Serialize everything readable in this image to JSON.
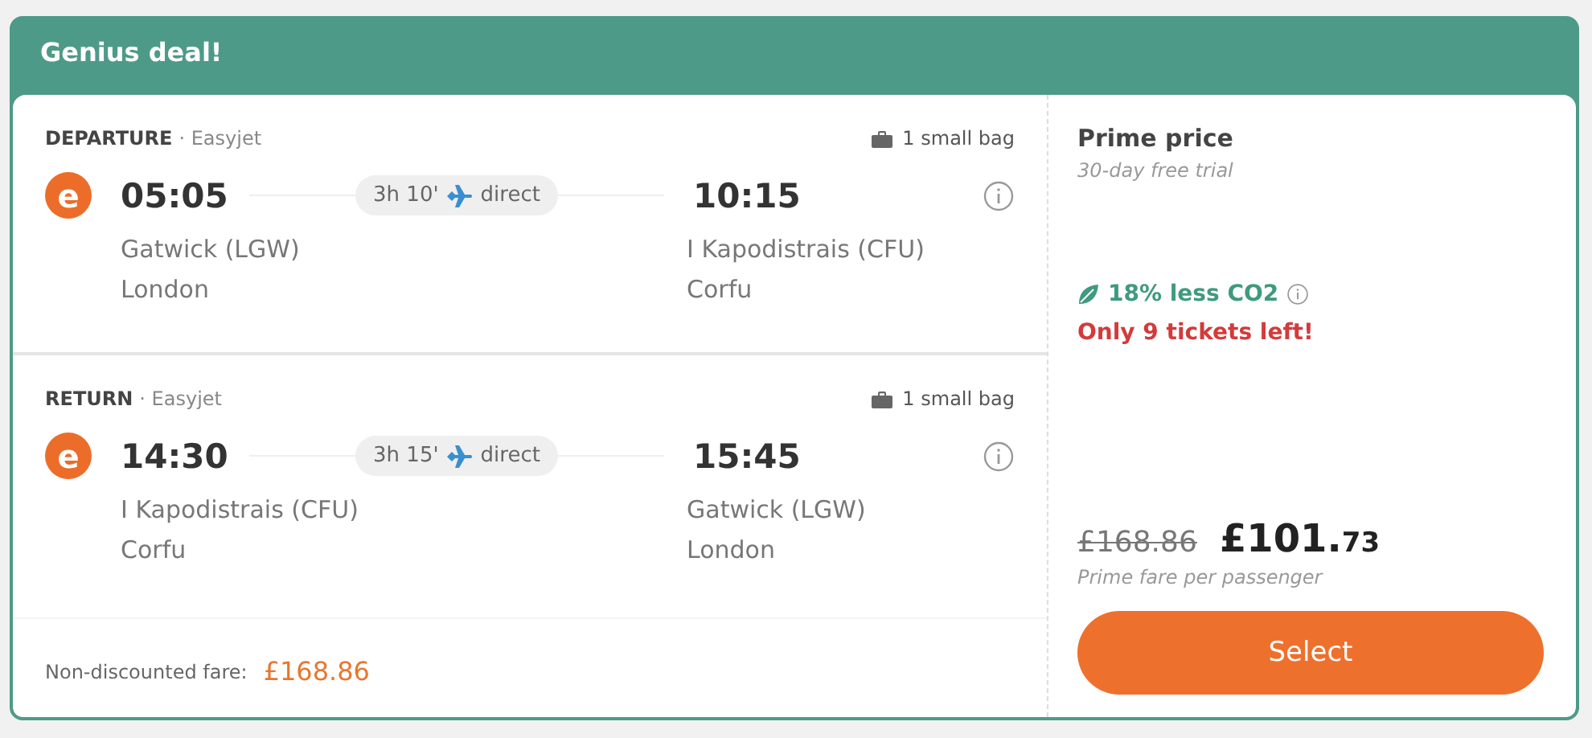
{
  "header": {
    "title": "Genius deal!"
  },
  "legs": [
    {
      "label": "DEPARTURE",
      "airline": "· Easyjet",
      "baggage": "1 small bag",
      "logo": "e",
      "depart_time": "05:05",
      "duration": "3h 10'",
      "stops": "direct",
      "arrive_time": "10:15",
      "from_airport": "Gatwick (LGW)",
      "from_city": "London",
      "to_airport": "I Kapodistrais (CFU)",
      "to_city": "Corfu"
    },
    {
      "label": "RETURN",
      "airline": "· Easyjet",
      "baggage": "1 small bag",
      "logo": "e",
      "depart_time": "14:30",
      "duration": "3h 15'",
      "stops": "direct",
      "arrive_time": "15:45",
      "from_airport": "I Kapodistrais (CFU)",
      "from_city": "Corfu",
      "to_airport": "Gatwick (LGW)",
      "to_city": "London"
    }
  ],
  "fare_note": {
    "label": "Non-discounted fare:",
    "amount": "£168.86"
  },
  "pricing": {
    "title": "Prime price",
    "subtitle": "30-day free trial",
    "emissions": "18% less CO2",
    "availability": "Only 9 tickets left!",
    "old_price": "£168.86",
    "price_main": "£101.",
    "price_cents": "73",
    "price_note": "Prime fare per passenger",
    "button": "Select"
  }
}
